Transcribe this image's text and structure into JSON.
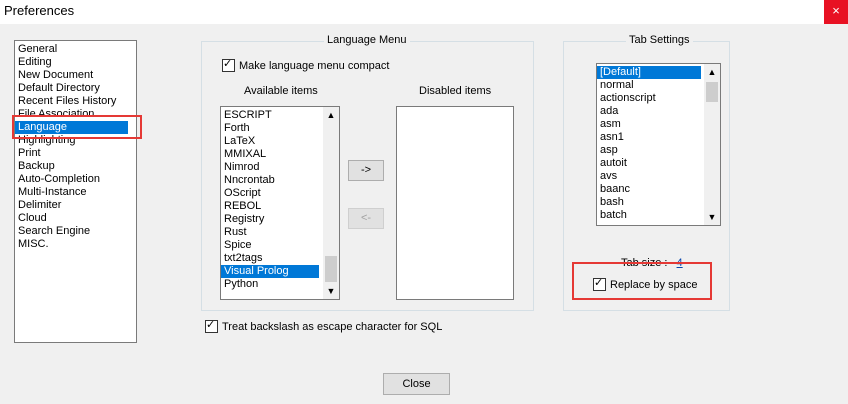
{
  "window": {
    "title": "Preferences",
    "close_glyph": "×"
  },
  "categories": [
    "General",
    "Editing",
    "New Document",
    "Default Directory",
    "Recent Files History",
    "File Association",
    "Language",
    "Highlighting",
    "Print",
    "Backup",
    "Auto-Completion",
    "Multi-Instance",
    "Delimiter",
    "Cloud",
    "Search Engine",
    "MISC."
  ],
  "selected_category": "Language",
  "language_menu": {
    "group_label": "Language Menu",
    "compact_label": "Make language menu compact",
    "compact_checked": true,
    "available_label": "Available items",
    "disabled_label": "Disabled items",
    "available_items": [
      "ESCRIPT",
      "Forth",
      "LaTeX",
      "MMIXAL",
      "Nimrod",
      "Nncrontab",
      "OScript",
      "REBOL",
      "Registry",
      "Rust",
      "Spice",
      "txt2tags",
      "Visual Prolog",
      "Python"
    ],
    "selected_available": "Visual Prolog",
    "disabled_items": [],
    "move_right_label": "->",
    "move_left_label": "<-"
  },
  "backslash_label": "Treat backslash as escape character for SQL",
  "backslash_checked": true,
  "tab_settings": {
    "group_label": "Tab Settings",
    "items": [
      "[Default]",
      "normal",
      "actionscript",
      "ada",
      "asm",
      "asn1",
      "asp",
      "autoit",
      "avs",
      "baanc",
      "bash",
      "batch"
    ],
    "selected": "[Default]",
    "tab_size_label": "Tab size :",
    "tab_size_value": "4",
    "replace_label": "Replace by space",
    "replace_checked": true
  },
  "close_button_label": "Close",
  "highlight_color": "#e53935",
  "selection_color": "#0078d7"
}
